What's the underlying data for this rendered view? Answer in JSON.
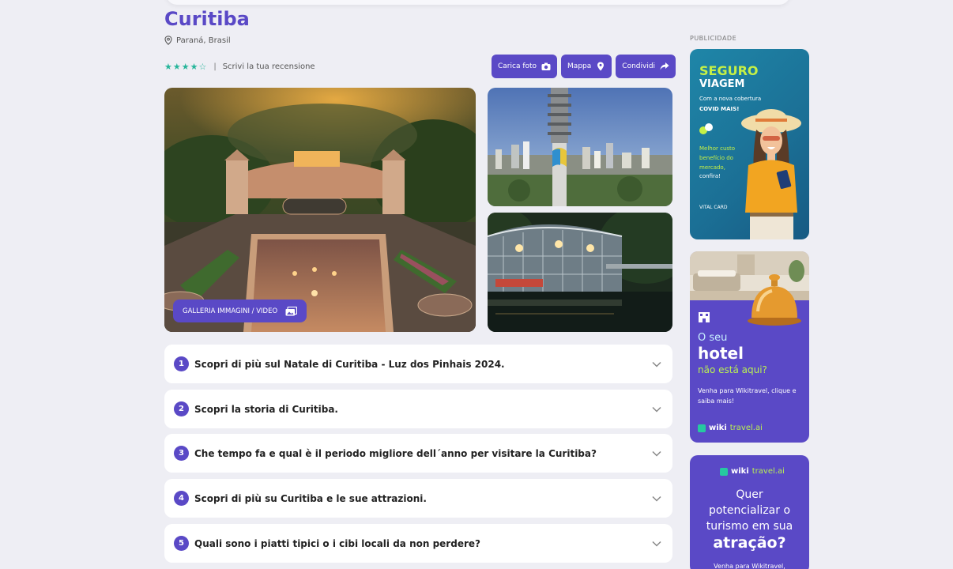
{
  "page": {
    "title": "Curitiba",
    "location": "Paraná, Brasil",
    "stars": "★★★★☆",
    "rating_separator": "|",
    "review_link": "Scrivi la tua recensione"
  },
  "actions": {
    "upload_photo": "Carica foto",
    "map": "Mappa",
    "share": "Condividi"
  },
  "gallery": {
    "button_label": "GALLERIA IMMAGINI / VIDEO"
  },
  "faq": [
    {
      "num": "1",
      "question": "Scopri di più sul Natale di Curitiba - Luz dos Pinhais 2024."
    },
    {
      "num": "2",
      "question": "Scopri la storia di Curitiba."
    },
    {
      "num": "3",
      "question": "Che tempo fa e qual è il periodo migliore dell´anno per visitare la Curitiba?"
    },
    {
      "num": "4",
      "question": "Scopri di più su Curitiba e le sue attrazioni."
    },
    {
      "num": "5",
      "question": "Quali sono i piatti tipici o i cibi locali da non perdere?"
    }
  ],
  "ads": {
    "label": "PUBLICIDADE",
    "ad1": {
      "headline1": "SEGURO",
      "headline2": "VIAGEM",
      "line1": "Com a nova cobertura",
      "line2": "COVID MAIS!",
      "line3": "Melhor custo benefício do mercado,",
      "line4": "confira!",
      "logo": "VITAL CARD"
    },
    "ad2": {
      "line1": "O seu",
      "line2": "hotel",
      "line3": "não está aqui?",
      "line4": "Venha para Wikitravel, clique e saiba mais!",
      "brand_a": "wiki",
      "brand_b": "travel.ai"
    },
    "ad3": {
      "brand_a": "wiki",
      "brand_b": "travel.ai",
      "line1": "Quer",
      "line2": "potencializar o",
      "line3": "turismo em sua",
      "line4": "atração?",
      "line5": "Venha para Wikitravel,"
    }
  },
  "colors": {
    "accent": "#5a49c6",
    "star": "#26b59a",
    "background": "#eeeef4"
  },
  "icons": [
    "pin-icon",
    "camera-icon",
    "map-pin-icon",
    "share-icon",
    "gallery-icon",
    "chevron-down-icon"
  ]
}
